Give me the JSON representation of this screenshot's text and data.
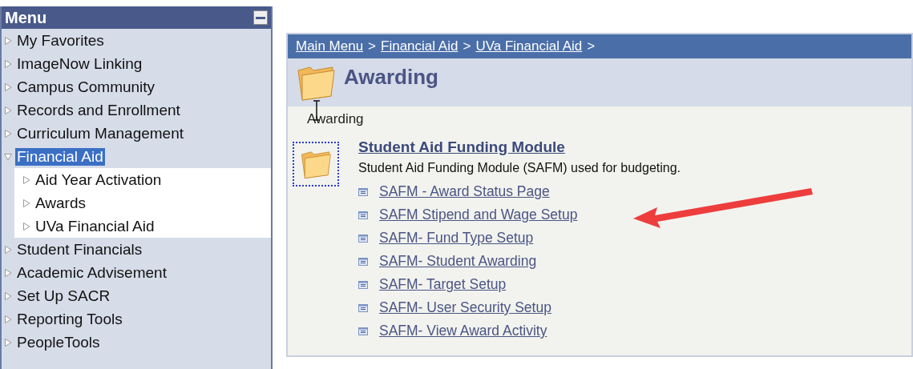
{
  "menu": {
    "title": "Menu",
    "items": [
      {
        "label": "My Favorites",
        "expanded": false,
        "selected": false
      },
      {
        "label": "ImageNow Linking",
        "expanded": false,
        "selected": false
      },
      {
        "label": "Campus Community",
        "expanded": false,
        "selected": false
      },
      {
        "label": "Records and Enrollment",
        "expanded": false,
        "selected": false
      },
      {
        "label": "Curriculum Management",
        "expanded": false,
        "selected": false
      },
      {
        "label": "Financial Aid",
        "expanded": true,
        "selected": true,
        "children": [
          {
            "label": "Aid Year Activation",
            "expanded": false,
            "selected": false
          },
          {
            "label": "Awards",
            "expanded": false,
            "selected": false
          },
          {
            "label": "UVa Financial Aid",
            "expanded": false,
            "selected": false
          }
        ]
      },
      {
        "label": "Student Financials",
        "expanded": false,
        "selected": false
      },
      {
        "label": "Academic Advisement",
        "expanded": false,
        "selected": false
      },
      {
        "label": "Set Up SACR",
        "expanded": false,
        "selected": false
      },
      {
        "label": "Reporting Tools",
        "expanded": false,
        "selected": false
      },
      {
        "label": "PeopleTools",
        "expanded": false,
        "selected": false
      }
    ]
  },
  "breadcrumb": {
    "links": [
      "Main Menu",
      "Financial Aid",
      "UVa Financial Aid"
    ],
    "separator": ">"
  },
  "page_title": "Awarding",
  "subtitle": "Awarding",
  "module": {
    "title": "Student Aid Funding Module",
    "description": "Student Aid Funding Module (SAFM) used for budgeting.",
    "links": [
      "SAFM - Award Status Page",
      "SAFM Stipend and Wage Setup",
      "SAFM- Fund Type Setup",
      "SAFM- Student Awarding",
      "SAFM- Target Setup",
      "SAFM- User Security Setup",
      "SAFM- View Award Activity"
    ]
  }
}
